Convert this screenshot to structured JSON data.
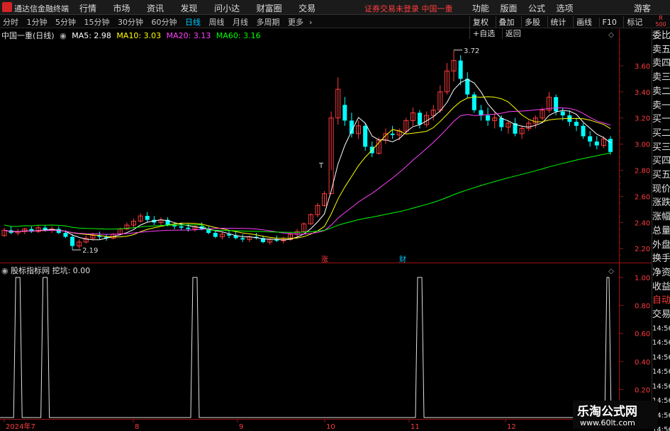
{
  "app": {
    "title": "通达信金融终端"
  },
  "menus": [
    "行情",
    "市场",
    "资讯",
    "发现",
    "问小达",
    "财富圈",
    "交易"
  ],
  "status_text": "证券交易未登录  中国一重",
  "right_menus": [
    "功能",
    "版面",
    "公式",
    "选项"
  ],
  "guest": "游客",
  "periods": [
    "分时",
    "1分钟",
    "5分钟",
    "15分钟",
    "30分钟",
    "60分钟",
    "日线",
    "周线",
    "月线",
    "多周期",
    "更多"
  ],
  "active_period": "日线",
  "tools": [
    "复权",
    "叠加",
    "多股",
    "统计",
    "画线",
    "F10",
    "标记",
    "+自选",
    "返回"
  ],
  "rbadge": [
    "R",
    "500"
  ],
  "legend": {
    "name": "中国一重(日线)",
    "ma5": "MA5: 2.98",
    "ma10": "MA10: 3.03",
    "ma20": "MA20: 3.13",
    "ma60": "MA60: 3.16"
  },
  "indicator": {
    "name": "股标指标网",
    "label": "挖坑: 0.00"
  },
  "colors": {
    "up": "#ff3c3c",
    "down": "#00ffff",
    "ma5": "#ffffff",
    "ma10": "#ffff00",
    "ma20": "#ff40ff",
    "ma60": "#00ff00"
  },
  "price_axis": [
    "3.60",
    "3.40",
    "3.20",
    "3.00",
    "2.80",
    "2.60",
    "2.40",
    "2.20"
  ],
  "ind_axis": [
    "1.00",
    "0.80",
    "0.60",
    "0.40",
    "0.20"
  ],
  "x_labels": [
    "2024年7",
    "8",
    "9",
    "10",
    "11",
    "12"
  ],
  "annotations": {
    "high": "3.72",
    "low": "2.19",
    "zhang": "涨",
    "cai": "财",
    "t": "T"
  },
  "right_panel": [
    "委比",
    "卖五",
    "卖四",
    "卖三",
    "卖二",
    "卖一",
    "买一",
    "买二",
    "买三",
    "买四",
    "买五",
    "现价",
    "涨跌",
    "涨幅",
    "总量",
    "外盘",
    "换手",
    "净资",
    "收益",
    "自动",
    "交易"
  ],
  "time_cells": [
    "14:56",
    "14:56",
    "14:56",
    "14:56",
    "14:56",
    "14:56",
    "14:56",
    "14:56"
  ],
  "watermark": {
    "title": "乐淘公式网",
    "url": "www.60lt.com"
  },
  "chart_data": {
    "type": "candlestick",
    "ylim": [
      2.12,
      3.8
    ],
    "high_label": 3.72,
    "low_label": 2.19,
    "ohlc": [
      [
        2.3,
        2.36,
        2.29,
        2.34
      ],
      [
        2.34,
        2.37,
        2.31,
        2.32
      ],
      [
        2.32,
        2.35,
        2.3,
        2.33
      ],
      [
        2.33,
        2.36,
        2.31,
        2.35
      ],
      [
        2.35,
        2.37,
        2.32,
        2.33
      ],
      [
        2.33,
        2.38,
        2.32,
        2.36
      ],
      [
        2.36,
        2.38,
        2.33,
        2.34
      ],
      [
        2.34,
        2.37,
        2.32,
        2.35
      ],
      [
        2.35,
        2.37,
        2.31,
        2.32
      ],
      [
        2.32,
        2.34,
        2.28,
        2.29
      ],
      [
        2.29,
        2.31,
        2.19,
        2.22
      ],
      [
        2.22,
        2.27,
        2.2,
        2.25
      ],
      [
        2.25,
        2.3,
        2.24,
        2.28
      ],
      [
        2.28,
        2.32,
        2.26,
        2.3
      ],
      [
        2.3,
        2.33,
        2.27,
        2.29
      ],
      [
        2.29,
        2.31,
        2.26,
        2.28
      ],
      [
        2.28,
        2.32,
        2.27,
        2.31
      ],
      [
        2.31,
        2.36,
        2.3,
        2.35
      ],
      [
        2.35,
        2.4,
        2.34,
        2.38
      ],
      [
        2.38,
        2.43,
        2.36,
        2.41
      ],
      [
        2.41,
        2.47,
        2.4,
        2.45
      ],
      [
        2.45,
        2.48,
        2.4,
        2.42
      ],
      [
        2.42,
        2.45,
        2.38,
        2.4
      ],
      [
        2.4,
        2.44,
        2.38,
        2.42
      ],
      [
        2.42,
        2.44,
        2.37,
        2.38
      ],
      [
        2.38,
        2.4,
        2.35,
        2.37
      ],
      [
        2.37,
        2.4,
        2.34,
        2.36
      ],
      [
        2.36,
        2.39,
        2.33,
        2.35
      ],
      [
        2.35,
        2.38,
        2.33,
        2.37
      ],
      [
        2.37,
        2.4,
        2.34,
        2.35
      ],
      [
        2.35,
        2.37,
        2.31,
        2.32
      ],
      [
        2.32,
        2.34,
        2.28,
        2.29
      ],
      [
        2.29,
        2.33,
        2.27,
        2.31
      ],
      [
        2.31,
        2.34,
        2.28,
        2.3
      ],
      [
        2.3,
        2.33,
        2.27,
        2.28
      ],
      [
        2.28,
        2.31,
        2.25,
        2.27
      ],
      [
        2.27,
        2.3,
        2.25,
        2.29
      ],
      [
        2.29,
        2.32,
        2.27,
        2.28
      ],
      [
        2.28,
        2.3,
        2.24,
        2.25
      ],
      [
        2.25,
        2.28,
        2.23,
        2.27
      ],
      [
        2.27,
        2.3,
        2.25,
        2.26
      ],
      [
        2.26,
        2.29,
        2.24,
        2.27
      ],
      [
        2.27,
        2.32,
        2.26,
        2.31
      ],
      [
        2.31,
        2.35,
        2.29,
        2.33
      ],
      [
        2.33,
        2.4,
        2.32,
        2.39
      ],
      [
        2.39,
        2.47,
        2.38,
        2.46
      ],
      [
        2.46,
        2.55,
        2.44,
        2.53
      ],
      [
        2.53,
        2.64,
        2.52,
        2.62
      ],
      [
        2.62,
        3.25,
        2.8,
        3.2
      ],
      [
        3.2,
        3.51,
        3.15,
        3.42
      ],
      [
        3.3,
        3.36,
        3.14,
        3.18
      ],
      [
        3.18,
        3.24,
        3.05,
        3.08
      ],
      [
        3.08,
        3.18,
        3.04,
        3.14
      ],
      [
        3.14,
        3.16,
        2.95,
        2.98
      ],
      [
        2.98,
        3.02,
        2.9,
        2.93
      ],
      [
        2.93,
        3.05,
        2.92,
        3.03
      ],
      [
        3.03,
        3.12,
        3.0,
        3.08
      ],
      [
        3.08,
        3.14,
        3.04,
        3.07
      ],
      [
        3.07,
        3.12,
        3.03,
        3.1
      ],
      [
        3.1,
        3.2,
        3.08,
        3.18
      ],
      [
        3.18,
        3.28,
        3.14,
        3.24
      ],
      [
        3.24,
        3.26,
        3.12,
        3.15
      ],
      [
        3.15,
        3.25,
        3.13,
        3.22
      ],
      [
        3.22,
        3.3,
        3.18,
        3.26
      ],
      [
        3.26,
        3.45,
        3.24,
        3.4
      ],
      [
        3.4,
        3.62,
        3.38,
        3.56
      ],
      [
        3.56,
        3.72,
        3.48,
        3.64
      ],
      [
        3.64,
        3.68,
        3.45,
        3.5
      ],
      [
        3.5,
        3.55,
        3.35,
        3.38
      ],
      [
        3.38,
        3.4,
        3.24,
        3.26
      ],
      [
        3.26,
        3.3,
        3.18,
        3.22
      ],
      [
        3.22,
        3.28,
        3.14,
        3.18
      ],
      [
        3.18,
        3.24,
        3.12,
        3.2
      ],
      [
        3.2,
        3.22,
        3.1,
        3.13
      ],
      [
        3.13,
        3.18,
        3.08,
        3.16
      ],
      [
        3.16,
        3.2,
        3.06,
        3.08
      ],
      [
        3.08,
        3.14,
        3.04,
        3.12
      ],
      [
        3.12,
        3.18,
        3.1,
        3.16
      ],
      [
        3.16,
        3.22,
        3.12,
        3.2
      ],
      [
        3.2,
        3.28,
        3.18,
        3.26
      ],
      [
        3.26,
        3.4,
        3.24,
        3.36
      ],
      [
        3.36,
        3.38,
        3.22,
        3.25
      ],
      [
        3.25,
        3.28,
        3.18,
        3.22
      ],
      [
        3.22,
        3.26,
        3.14,
        3.17
      ],
      [
        3.17,
        3.2,
        3.1,
        3.14
      ],
      [
        3.14,
        3.16,
        3.04,
        3.06
      ],
      [
        3.06,
        3.1,
        2.98,
        3.02
      ],
      [
        3.02,
        3.06,
        2.96,
        2.99
      ],
      [
        2.99,
        3.06,
        2.97,
        3.04
      ],
      [
        3.04,
        3.06,
        2.92,
        2.94
      ]
    ],
    "indicator_peaks": [
      2,
      6,
      28,
      61
    ]
  }
}
